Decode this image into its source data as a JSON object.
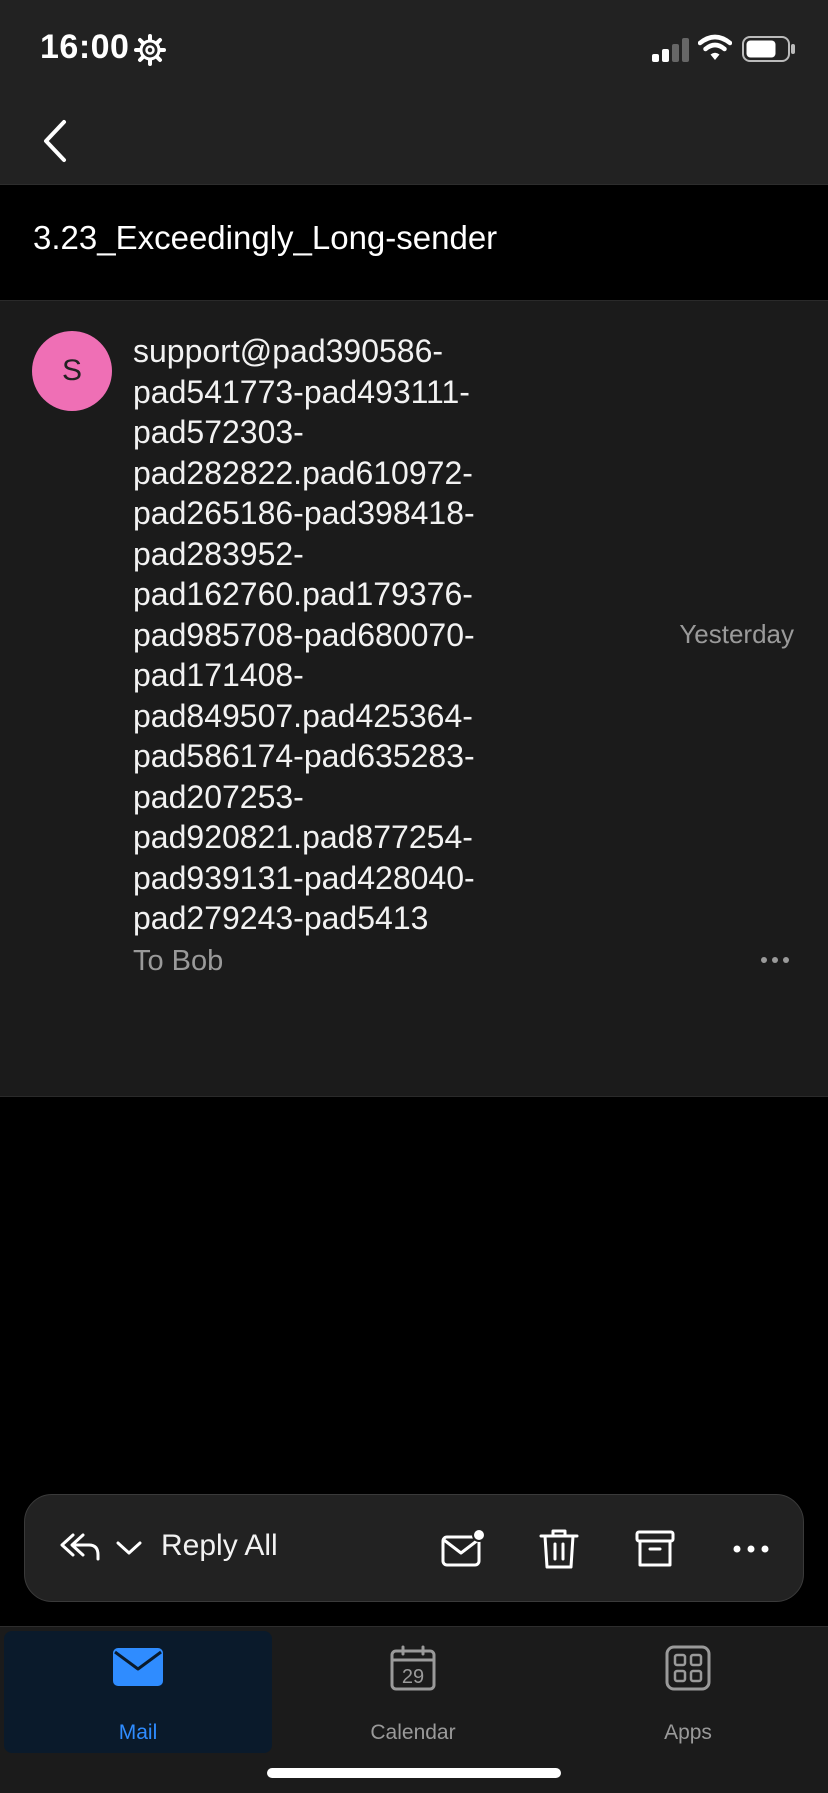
{
  "status": {
    "time": "16:00"
  },
  "header": {
    "subject": "3.23_Exceedingly_Long-sender"
  },
  "message": {
    "avatar_letter": "S",
    "sender_lines": [
      "support@pad390586-",
      "pad541773-pad493111-",
      "pad572303-",
      "pad282822.pad610972-",
      "pad265186-pad398418-",
      "pad283952-",
      "pad162760.pad179376-",
      "pad985708-pad680070-",
      "pad171408-",
      "pad849507.pad425364-",
      "pad586174-pad635283-",
      "pad207253-",
      "pad920821.pad877254-",
      "pad939131-pad428040-",
      "pad279243-pad5413"
    ],
    "time": "Yesterday",
    "to": "To Bob"
  },
  "toolbar": {
    "reply_label": "Reply All"
  },
  "tabs": {
    "mail": "Mail",
    "calendar": "Calendar",
    "calendar_day": "29",
    "apps": "Apps"
  },
  "colors": {
    "accent": "#2f8cff",
    "avatar": "#ef6fb5"
  }
}
